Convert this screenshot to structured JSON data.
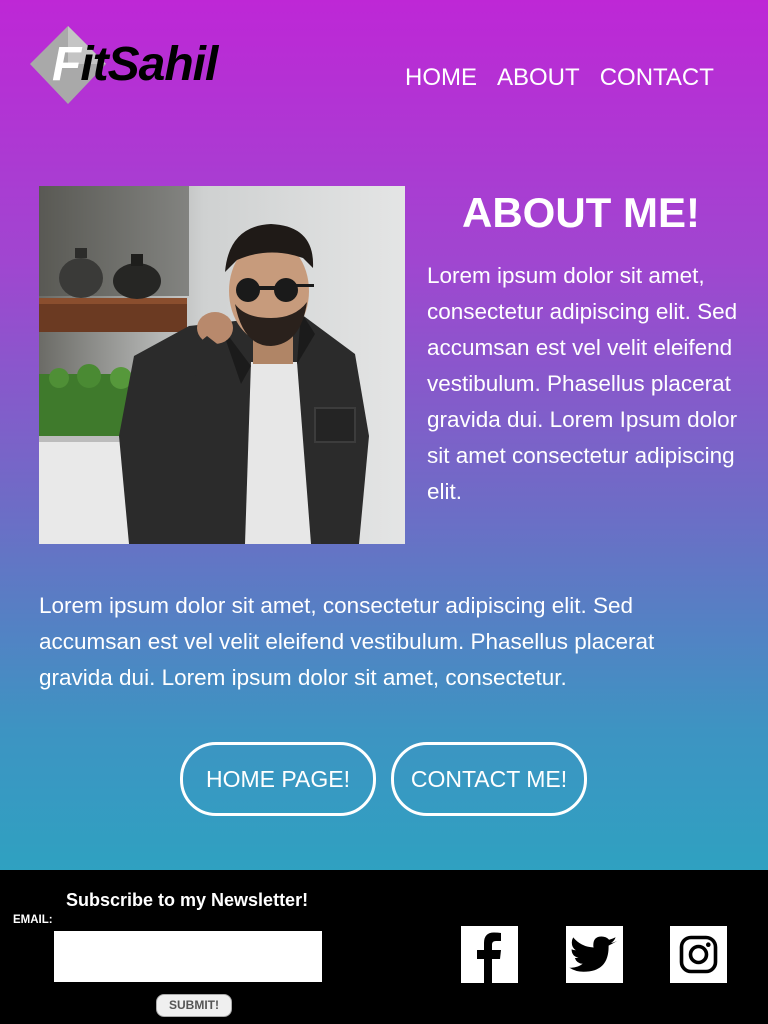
{
  "brand": {
    "logo_text": "FitSahil",
    "logo_first": "F",
    "logo_rest": "itSahil"
  },
  "nav": {
    "items": [
      {
        "label": "HOME"
      },
      {
        "label": "ABOUT"
      },
      {
        "label": "CONTACT"
      }
    ]
  },
  "about": {
    "title": "ABOUT ME!",
    "photo_alt": "Portrait of a man with sunglasses and a dark jacket",
    "text": "Lorem ipsum dolor sit amet, consectetur adipiscing elit. Sed accumsan est vel velit eleifend vestibulum. Phasellus placerat gravida dui. Lorem Ipsum dolor sit amet consectetur adipiscing elit."
  },
  "intro_paragraph": "Lorem ipsum dolor sit amet, consectetur adipiscing elit. Sed accumsan est vel velit eleifend vestibulum. Phasellus placerat gravida dui. Lorem ipsum dolor sit amet, consectetur.",
  "buttons": {
    "home": "HOME PAGE!",
    "contact": "CONTACT ME!"
  },
  "newsletter": {
    "title": "Subscribe to my Newsletter!",
    "email_label": "EMAIL:",
    "email_value": "",
    "submit_label": "SUBMIT!"
  },
  "social": [
    {
      "name": "facebook-icon"
    },
    {
      "name": "twitter-icon"
    },
    {
      "name": "instagram-icon"
    }
  ],
  "colors": {
    "gradient_top": "#be27d6",
    "gradient_bottom": "#2fa1c1",
    "footer": "#000000",
    "text": "#ffffff"
  }
}
